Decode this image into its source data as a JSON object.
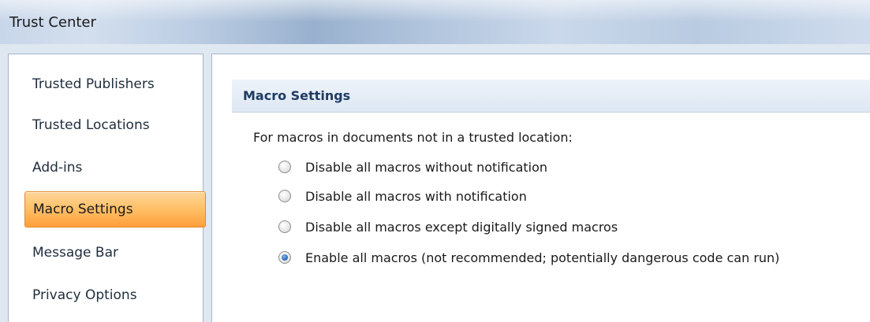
{
  "window": {
    "title": "Trust Center"
  },
  "sidebar": {
    "items": [
      {
        "label": "Trusted Publishers",
        "selected": false
      },
      {
        "label": "Trusted Locations",
        "selected": false
      },
      {
        "label": "Add-ins",
        "selected": false
      },
      {
        "label": "Macro Settings",
        "selected": true
      },
      {
        "label": "Message Bar",
        "selected": false
      },
      {
        "label": "Privacy Options",
        "selected": false
      }
    ]
  },
  "main": {
    "section_title": "Macro Settings",
    "prompt": "For macros in documents not in a trusted location:",
    "options": [
      {
        "label": "Disable all macros without notification",
        "checked": false
      },
      {
        "label": "Disable all macros with notification",
        "checked": false
      },
      {
        "label": "Disable all macros except digitally signed macros",
        "checked": false
      },
      {
        "label": "Enable all macros (not recommended; potentially dangerous code can run)",
        "checked": true
      }
    ]
  },
  "colors": {
    "selected_item_bg": "#ffc26a",
    "section_header_text": "#1f3b63",
    "radio_checked": "#2f6fc0"
  },
  "icons": {
    "radio_checked": "radio-checked-icon",
    "radio_unchecked": "radio-unchecked-icon"
  }
}
